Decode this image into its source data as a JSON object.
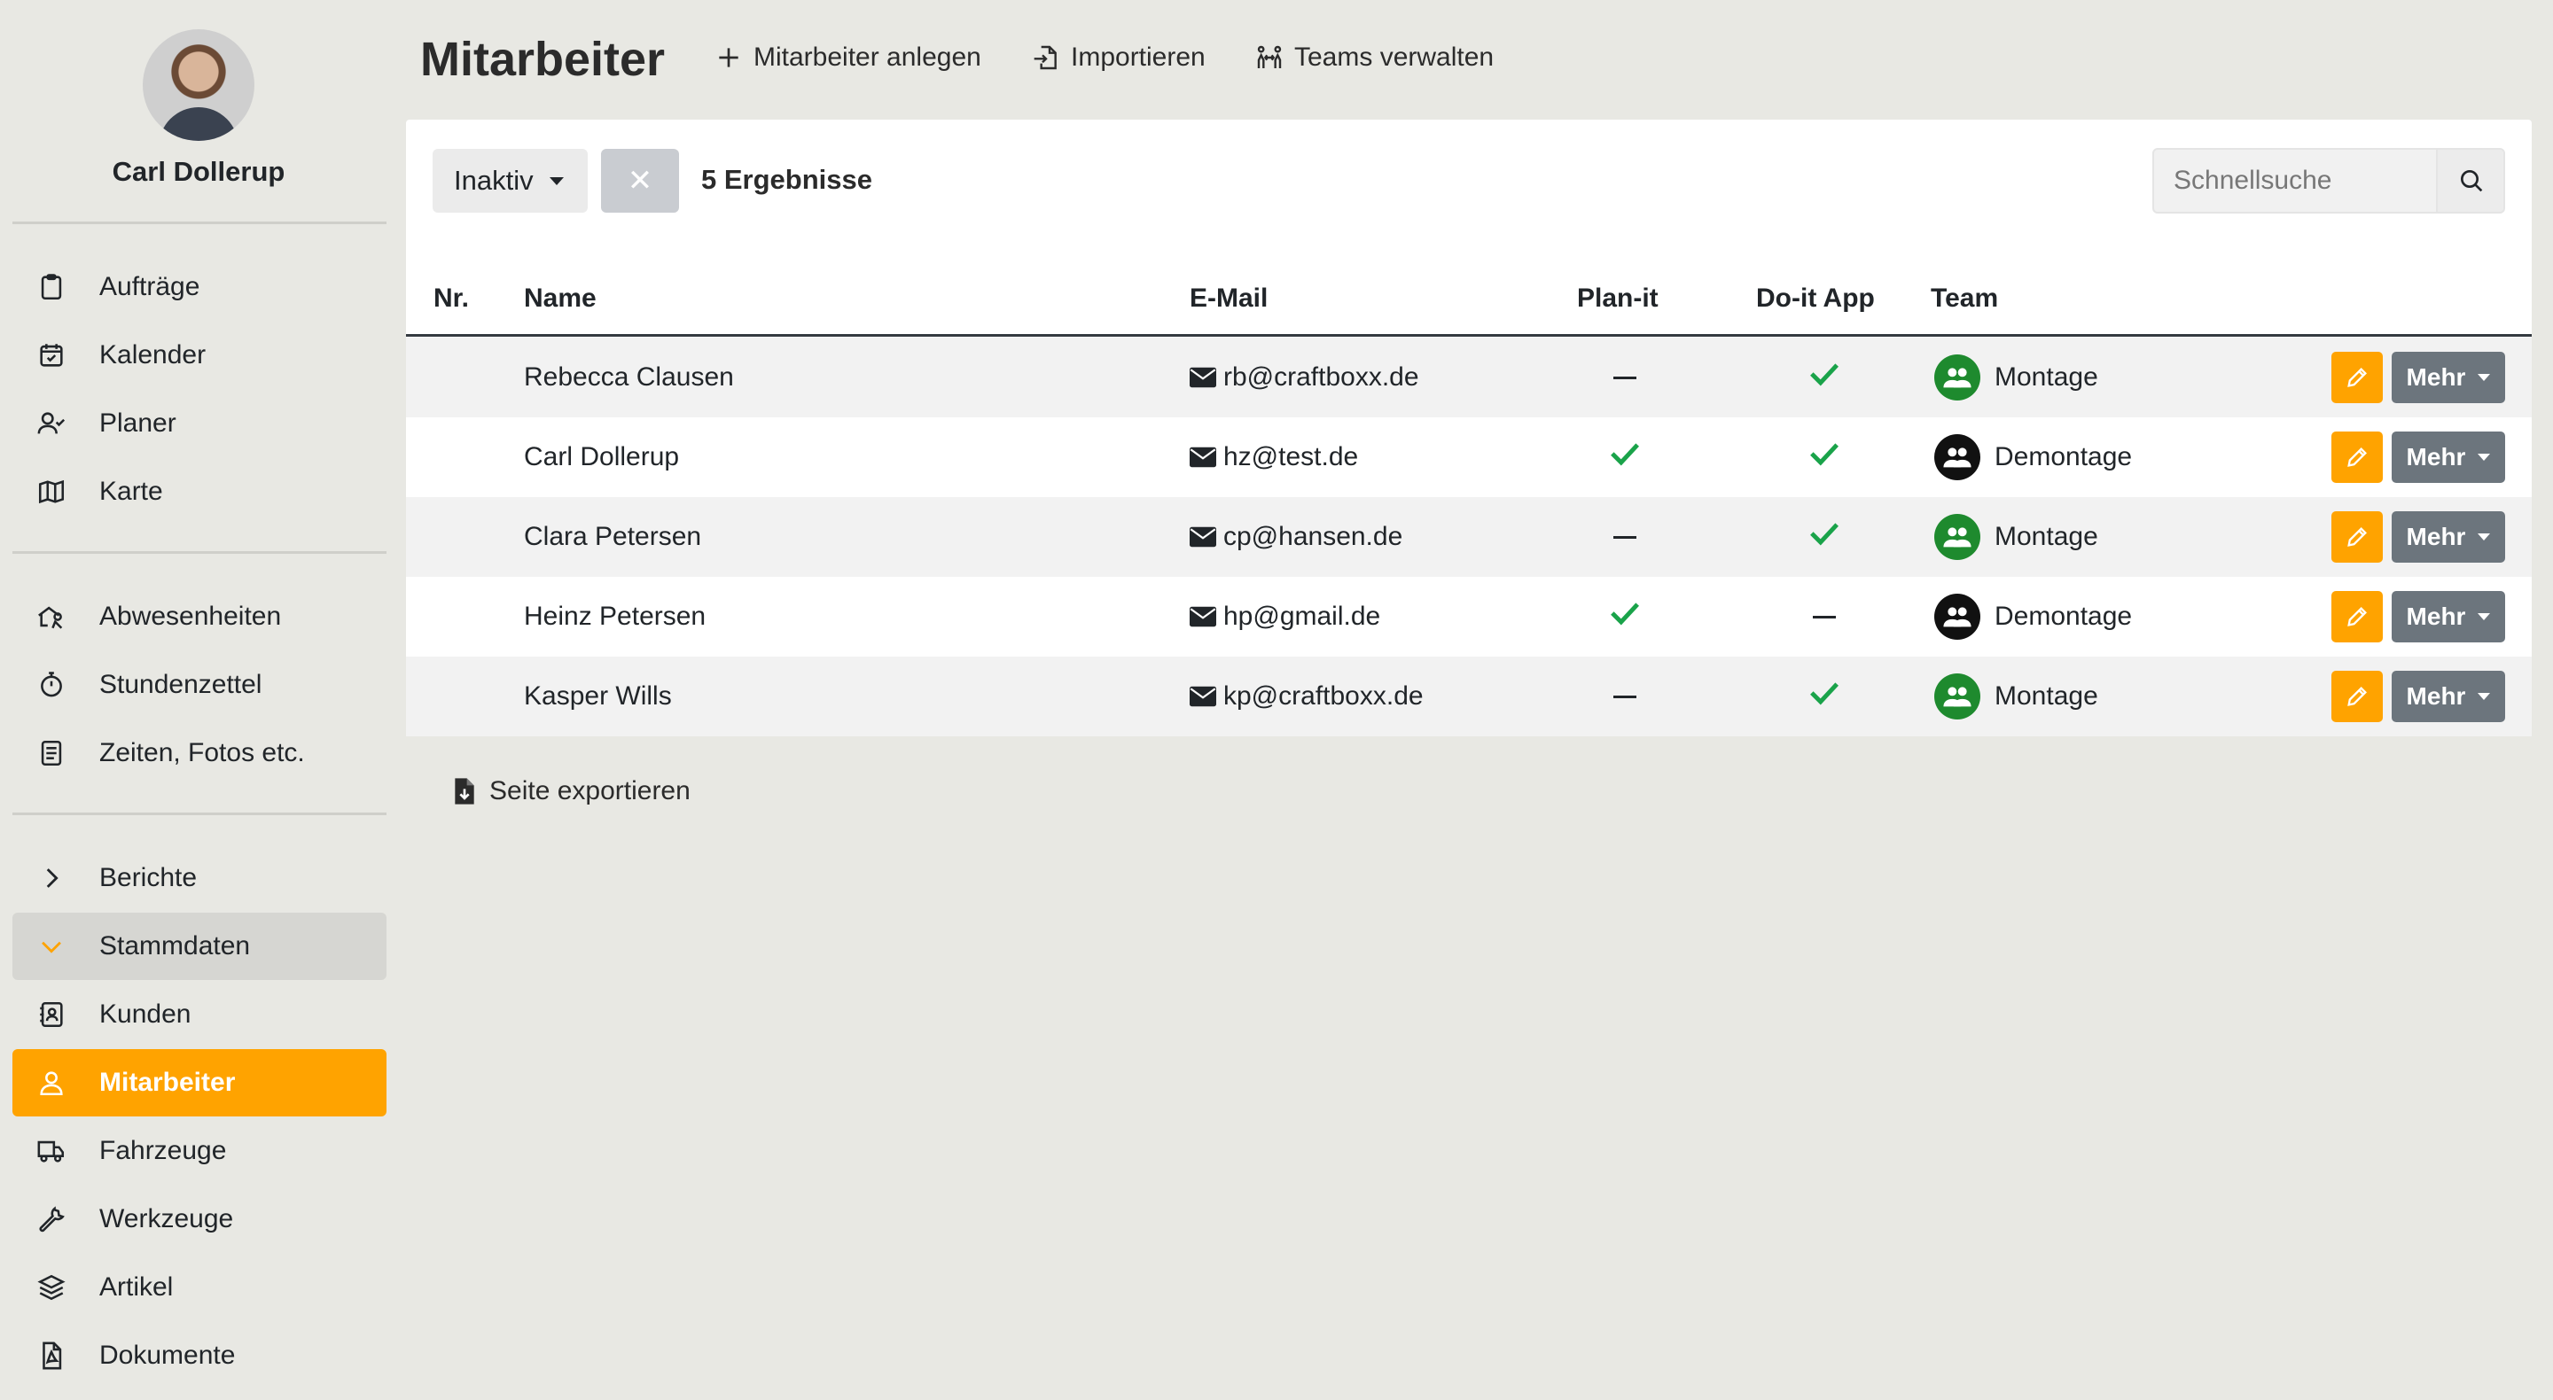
{
  "user": {
    "name": "Carl Dollerup"
  },
  "sidebar": {
    "group1": [
      {
        "label": "Aufträge",
        "icon": "clipboard-icon"
      },
      {
        "label": "Kalender",
        "icon": "calendar-check-icon"
      },
      {
        "label": "Planer",
        "icon": "person-check-icon"
      },
      {
        "label": "Karte",
        "icon": "map-icon"
      }
    ],
    "group2": [
      {
        "label": "Abwesenheiten",
        "icon": "house-person-icon"
      },
      {
        "label": "Stundenzettel",
        "icon": "stopwatch-icon"
      },
      {
        "label": "Zeiten, Fotos etc.",
        "icon": "journal-icon"
      }
    ],
    "group3": [
      {
        "label": "Berichte",
        "icon": "chevron-right-icon"
      },
      {
        "label": "Stammdaten",
        "icon": "chevron-down-icon",
        "state": "expanded"
      },
      {
        "label": "Kunden",
        "icon": "contact-card-icon"
      },
      {
        "label": "Mitarbeiter",
        "icon": "person-icon",
        "state": "active"
      },
      {
        "label": "Fahrzeuge",
        "icon": "truck-icon"
      },
      {
        "label": "Werkzeuge",
        "icon": "wrench-icon"
      },
      {
        "label": "Artikel",
        "icon": "layers-icon"
      },
      {
        "label": "Dokumente",
        "icon": "pdf-file-icon"
      }
    ]
  },
  "header": {
    "title": "Mitarbeiter",
    "actions": [
      {
        "label": "Mitarbeiter anlegen",
        "icon": "plus-icon"
      },
      {
        "label": "Importieren",
        "icon": "file-import-icon"
      },
      {
        "label": "Teams verwalten",
        "icon": "people-arrows-icon"
      }
    ]
  },
  "filters": {
    "status_label": "Inaktiv",
    "clear_symbol": "✕",
    "result_count": "5 Ergebnisse",
    "search_placeholder": "Schnellsuche"
  },
  "table": {
    "columns": [
      "Nr.",
      "Name",
      "E-Mail",
      "Plan-it",
      "Do-it App",
      "Team"
    ],
    "rows": [
      {
        "nr": "",
        "name": "Rebecca Clausen",
        "email": "rb@craftboxx.de",
        "plan_it": false,
        "do_it": true,
        "team": "Montage",
        "team_color": "#1e8a2e"
      },
      {
        "nr": "",
        "name": "Carl Dollerup",
        "email": "hz@test.de",
        "plan_it": true,
        "do_it": true,
        "team": "Demontage",
        "team_color": "#111111"
      },
      {
        "nr": "",
        "name": "Clara Petersen",
        "email": "cp@hansen.de",
        "plan_it": false,
        "do_it": true,
        "team": "Montage",
        "team_color": "#1e8a2e"
      },
      {
        "nr": "",
        "name": "Heinz Petersen",
        "email": "hp@gmail.de",
        "plan_it": true,
        "do_it": false,
        "team": "Demontage",
        "team_color": "#111111"
      },
      {
        "nr": "",
        "name": "Kasper Wills",
        "email": "kp@craftboxx.de",
        "plan_it": false,
        "do_it": true,
        "team": "Montage",
        "team_color": "#1e8a2e"
      }
    ],
    "more_label": "Mehr"
  },
  "footer": {
    "export_label": "Seite exportieren"
  },
  "colors": {
    "accent": "#ffa300",
    "success": "#1aa34a",
    "secondary": "#6c757d"
  }
}
